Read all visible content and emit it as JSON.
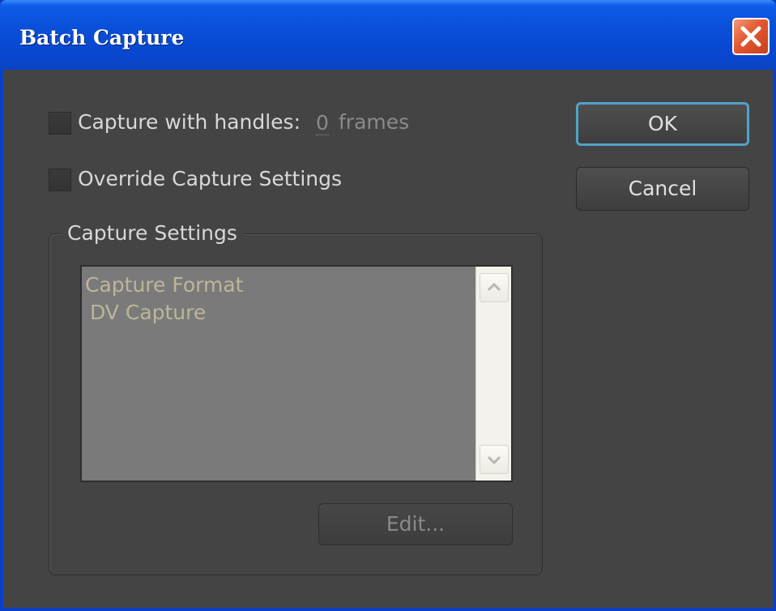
{
  "window": {
    "title": "Batch Capture",
    "close_icon": "close-icon"
  },
  "options": {
    "capture_with_handles": {
      "label": "Capture with handles:",
      "checked": false,
      "value": "0",
      "unit": "frames"
    },
    "override_capture_settings": {
      "label": "Override Capture Settings",
      "checked": false
    }
  },
  "buttons": {
    "ok": "OK",
    "cancel": "Cancel",
    "edit": "Edit..."
  },
  "capture_settings": {
    "legend": "Capture Settings",
    "lines": [
      "Capture Format",
      " DV Capture"
    ]
  },
  "colors": {
    "titlebar": "#0a4fd8",
    "dialog_bg": "#444444",
    "ok_focus_border": "#4fa3c8",
    "close_button": "#e2572f",
    "list_text": "#bdb59a"
  }
}
